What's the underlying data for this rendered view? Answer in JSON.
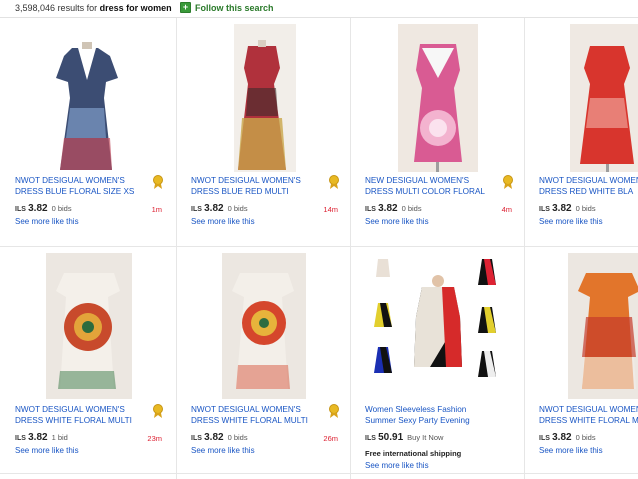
{
  "header": {
    "results_count": "3,598,046",
    "results_text": "results for",
    "query": "dress for women",
    "follow_label": "Follow this search"
  },
  "colors": {
    "link": "#1a56c4",
    "time_left": "#dd2233",
    "follow_green": "#2a7a2a",
    "divider": "#e6e6e6"
  },
  "listings": [
    {
      "title": "NWOT DESIGUAL WOMEN'S DRESS BLUE FLORAL SIZE XS",
      "currency": "ILS",
      "price": "3.82",
      "bids": "0 bids",
      "time_left": "1m",
      "more": "See more like this",
      "badge_icon": "top-rated-seller-icon"
    },
    {
      "title": "NWOT DESIGUAL WOMEN'S DRESS BLUE RED MULTI",
      "currency": "ILS",
      "price": "3.82",
      "bids": "0 bids",
      "time_left": "14m",
      "more": "See more like this",
      "badge_icon": "top-rated-seller-icon"
    },
    {
      "title": "NEW DESIGUAL WOMEN'S DRESS MULTI COLOR FLORAL",
      "currency": "ILS",
      "price": "3.82",
      "bids": "0 bids",
      "time_left": "4m",
      "more": "See more like this",
      "badge_icon": "top-rated-seller-icon"
    },
    {
      "title": "NWOT DESIGUAL WOMEN'S DRESS RED WHITE BLA",
      "currency": "ILS",
      "price": "3.82",
      "bids": "0 bids",
      "time_left": "",
      "more": "See more like this"
    },
    {
      "title": "NWOT DESIGUAL WOMEN'S DRESS WHITE FLORAL MULTI",
      "currency": "ILS",
      "price": "3.82",
      "bids": "1 bid",
      "time_left": "23m",
      "more": "See more like this",
      "badge_icon": "top-rated-seller-icon"
    },
    {
      "title": "NWOT DESIGUAL WOMEN'S DRESS WHITE FLORAL MULTI",
      "currency": "ILS",
      "price": "3.82",
      "bids": "0 bids",
      "time_left": "26m",
      "more": "See more like this",
      "badge_icon": "top-rated-seller-icon"
    },
    {
      "title": "Women Sleeveless Fashion Summer Sexy Party Evening",
      "currency": "ILS",
      "price": "50.91",
      "bids": "Buy It Now",
      "time_left": "",
      "shipping": "Free international shipping",
      "more": "See more like this"
    },
    {
      "title": "NWOT DESIGUAL WOMEN'S DRESS WHITE FLORAL MULTI",
      "currency": "ILS",
      "price": "3.82",
      "bids": "0 bids",
      "time_left": "",
      "more": "See more like this"
    }
  ],
  "icons": {
    "follow": "plus-icon",
    "badge": "top-rated-seller-icon"
  }
}
